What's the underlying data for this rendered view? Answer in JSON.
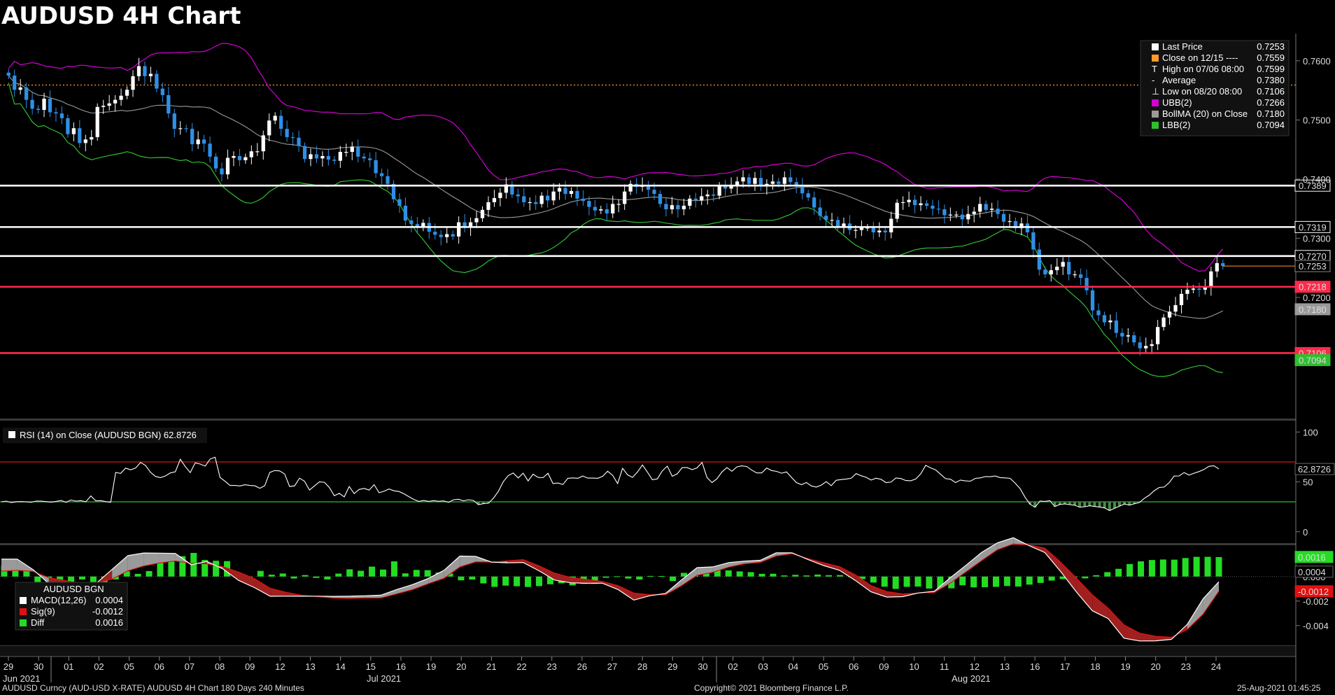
{
  "title": "AUDUSD 4H Chart",
  "footer": {
    "left": "AUDUSD Curncy (AUD-USD X-RATE) AUDUSD 4H Chart 180 Days 240 Minutes",
    "center": "Copyright© 2021 Bloomberg Finance L.P.",
    "right": "25-Aug-2021 01:45:25"
  },
  "colors": {
    "up": "#ffffff",
    "down": "#2f8fe6",
    "ubb": "#d400d4",
    "bollma": "#9a9a9a",
    "lbb": "#2fbf2f",
    "hline_white": "#ffffff",
    "hline_red": "#ff2a4a",
    "close_level": "#ff9a2a",
    "macd": "#ffffff",
    "sig": "#e01010",
    "diff": "#22dd22"
  },
  "chart_data": [
    {
      "type": "candlestick",
      "name": "price",
      "ylim": [
        0.7,
        0.7646
      ],
      "y_ticks": [
        "0.7600",
        "0.7500",
        "0.7400",
        "0.7300",
        "0.7200"
      ],
      "x_tick_labels": [
        "29",
        "30",
        "01",
        "02",
        "05",
        "06",
        "07",
        "08",
        "09",
        "12",
        "13",
        "14",
        "15",
        "16",
        "19",
        "20",
        "21",
        "22",
        "23",
        "26",
        "27",
        "28",
        "29",
        "30",
        "02",
        "03",
        "04",
        "05",
        "06",
        "09",
        "10",
        "11",
        "12",
        "13",
        "16",
        "17",
        "18",
        "19",
        "20",
        "23",
        "24"
      ],
      "month_labels": [
        "Jun 2021",
        "Jul 2021",
        "Aug 2021"
      ],
      "legend": [
        {
          "label": "Last Price",
          "value": "0.7253",
          "color": "#ffffff"
        },
        {
          "label": "Close on 12/15 ----",
          "value": "0.7559",
          "color": "#ff9a2a"
        },
        {
          "label": "High on 07/06 08:00",
          "value": "0.7599",
          "color": "none",
          "mark": "T"
        },
        {
          "label": "Average",
          "value": "0.7380",
          "color": "none",
          "mark": "-"
        },
        {
          "label": "Low on 08/20 08:00",
          "value": "0.7106",
          "color": "none",
          "mark": "⊥"
        },
        {
          "label": "UBB(2)",
          "value": "0.7266",
          "color": "#d400d4"
        },
        {
          "label": "BollMA (20)  on Close",
          "value": "0.7180",
          "color": "#9a9a9a"
        },
        {
          "label": "LBB(2)",
          "value": "0.7094",
          "color": "#2fbf2f"
        }
      ],
      "close_level": 0.7559,
      "horizontal_lines": [
        {
          "value": 0.7389,
          "label": "0.7389",
          "color": "#ffffff"
        },
        {
          "value": 0.7319,
          "label": "0.7319",
          "color": "#ffffff"
        },
        {
          "value": 0.727,
          "label": "0.7270",
          "color": "#ffffff"
        },
        {
          "value": 0.7218,
          "label": "0.7218",
          "color": "#ff2a4a"
        },
        {
          "value": 0.7106,
          "label": "0.7106",
          "color": "#ff2a4a"
        }
      ],
      "value_tags": [
        {
          "value": 0.7253,
          "label": "0.7253",
          "bg": "#000000",
          "fg": "#ffffff",
          "border": "#888888"
        },
        {
          "value": 0.718,
          "label": "0.7180",
          "bg": "#9a9a9a",
          "fg": "#000000",
          "border": "#9a9a9a"
        },
        {
          "value": 0.7094,
          "label": "0.7094",
          "bg": "#2fbf2f",
          "fg": "#000000",
          "border": "#2fbf2f"
        }
      ],
      "series": [
        {
          "name": "Close",
          "values": [
            0.7575,
            0.7551,
            0.7555,
            0.7534,
            0.7519,
            0.7517,
            0.7536,
            0.7513,
            0.7511,
            0.7503,
            0.7476,
            0.7486,
            0.7461,
            0.7467,
            0.7471,
            0.7522,
            0.7524,
            0.7528,
            0.7534,
            0.7541,
            0.7551,
            0.7574,
            0.7591,
            0.7574,
            0.7578,
            0.7553,
            0.7542,
            0.7511,
            0.7485,
            0.7486,
            0.7485,
            0.7459,
            0.7467,
            0.746,
            0.7438,
            0.7418,
            0.7408,
            0.7436,
            0.7439,
            0.7432,
            0.7437,
            0.7447,
            0.7447,
            0.7474,
            0.7499,
            0.7507,
            0.7485,
            0.7471,
            0.747,
            0.7456,
            0.7434,
            0.7442,
            0.7435,
            0.7439,
            0.7433,
            0.7431,
            0.7446,
            0.7446,
            0.7455,
            0.7438,
            0.7435,
            0.7432,
            0.741,
            0.7405,
            0.7392,
            0.7366,
            0.7355,
            0.733,
            0.7324,
            0.7318,
            0.7326,
            0.7311,
            0.7306,
            0.7302,
            0.7307,
            0.7303,
            0.7327,
            0.7318,
            0.7327,
            0.7334,
            0.7348,
            0.7361,
            0.7368,
            0.7377,
            0.7391,
            0.7374,
            0.7371,
            0.7361,
            0.7361,
            0.7358,
            0.7372,
            0.7364,
            0.7379,
            0.7385,
            0.7375,
            0.738,
            0.7367,
            0.7363,
            0.7353,
            0.7347,
            0.7349,
            0.7342,
            0.7358,
            0.7358,
            0.7379,
            0.7392,
            0.7387,
            0.7389,
            0.7382,
            0.7375,
            0.7358,
            0.7349,
            0.7356,
            0.7349,
            0.7355,
            0.7367,
            0.7364,
            0.7371,
            0.7374,
            0.7372,
            0.7389,
            0.7384,
            0.7389,
            0.7396,
            0.7403,
            0.7392,
            0.7402,
            0.7388,
            0.7392,
            0.7396,
            0.7392,
            0.7403,
            0.7395,
            0.739,
            0.7376,
            0.7369,
            0.7352,
            0.7338,
            0.7331,
            0.7331,
            0.732,
            0.7325,
            0.7314,
            0.7314,
            0.7318,
            0.7318,
            0.731,
            0.7313,
            0.731,
            0.7333,
            0.736,
            0.7361,
            0.7365,
            0.7356,
            0.7359,
            0.7355,
            0.735,
            0.7349,
            0.7339,
            0.734,
            0.734,
            0.7332,
            0.7341,
            0.7345,
            0.7358,
            0.7348,
            0.735,
            0.7341,
            0.7328,
            0.7329,
            0.7317,
            0.7325,
            0.731,
            0.7281,
            0.7247,
            0.7239,
            0.7246,
            0.7252,
            0.726,
            0.7239,
            0.7239,
            0.7233,
            0.7212,
            0.7178,
            0.717,
            0.7158,
            0.7161,
            0.714,
            0.7134,
            0.7136,
            0.7124,
            0.7114,
            0.7118,
            0.7121,
            0.715,
            0.7166,
            0.7176,
            0.7187,
            0.7206,
            0.7213,
            0.7215,
            0.7213,
            0.7217,
            0.7244,
            0.7258,
            0.7253
          ]
        }
      ]
    },
    {
      "type": "line",
      "name": "rsi",
      "legend": "RSI (14)  on Close (AUDUSD BGN) 62.8726",
      "ylim": [
        -10,
        110
      ],
      "y_ticks": [
        "100",
        "50",
        "0"
      ],
      "levels": [
        70,
        30
      ],
      "last_value_label": "62.8726",
      "series": [
        {
          "name": "RSI (14)",
          "values": [
            30.0,
            30.7,
            29.2,
            30.1,
            30.2,
            30.0,
            29.6,
            30.8,
            30.6,
            30.2,
            29.7,
            30.4,
            31.3,
            29.6,
            31.8,
            30.7,
            31.2,
            30.1,
            35.9,
            31.0,
            31.2,
            30.2,
            29.6,
            59.5,
            58.5,
            63.8,
            62.1,
            63.9,
            69.5,
            66.5,
            59.6,
            55.5,
            54.3,
            56.0,
            59.0,
            60.2,
            72.7,
            65.4,
            59.3,
            69.1,
            67.9,
            65.8,
            72.9,
            74.8,
            54.4,
            50.6,
            46.4,
            46.4,
            45.9,
            47.1,
            46.4,
            46.1,
            43.6,
            46.2,
            59.4,
            61.4,
            61.0,
            57.9,
            45.4,
            46.0,
            53.7,
            50.7,
            41.8,
            45.9,
            50.1,
            49.6,
            44.4,
            36.1,
            38.5,
            35.0,
            45.4,
            38.3,
            42.4,
            43.5,
            41.8,
            47.2,
            39.1,
            40.6,
            42.9,
            41.0,
            40.4,
            38.1,
            35.2,
            32.4,
            30.4,
            31.3,
            30.4,
            31.2,
            30.5,
            30.9,
            29.5,
            32.1,
            32.6,
            31.0,
            32.1,
            31.3,
            27.2,
            28.2,
            28.6,
            33.5,
            40.4,
            50.2,
            56.3,
            58.9,
            54.0,
            58.7,
            51.0,
            57.7,
            54.5,
            54.2,
            58.6,
            48.3,
            48.9,
            47.3,
            53.6,
            54.0,
            53.6,
            55.9,
            53.8,
            53.8,
            53.6,
            55.6,
            60.7,
            56.6,
            48.3,
            63.6,
            57.1,
            54.5,
            59.9,
            67.0,
            59.8,
            52.1,
            53.0,
            61.1,
            65.8,
            55.6,
            58.1,
            64.4,
            64.3,
            62.3,
            64.1,
            69.5,
            54.3,
            49.3,
            53.1,
            60.0,
            64.3,
            60.7,
            65.0,
            66.1,
            65.4,
            61.8,
            59.0,
            59.0,
            63.9,
            61.4,
            60.5,
            58.7,
            60.0,
            54.5,
            49.3,
            47.2,
            49.4,
            45.9,
            44.8,
            46.8,
            50.2,
            46.2,
            51.6,
            52.3,
            52.9,
            53.6,
            58.3,
            56.2,
            54.6,
            51.8,
            53.7,
            52.6,
            49.3,
            49.7,
            53.9,
            53.4,
            51.3,
            51.1,
            52.9,
            58.1,
            66.6,
            64.0,
            62.0,
            57.6,
            53.2,
            52.7,
            49.3,
            51.8,
            51.0,
            50.7,
            53.5,
            54.0,
            55.3,
            55.2,
            55.9,
            54.3,
            54.0,
            53.5,
            48.8,
            43.3,
            34.6,
            27.7,
            24.6,
            30.7,
            30.4,
            31.2,
            25.3,
            27.4,
            28.0,
            27.2,
            26.6,
            24.7,
            25.1,
            26.1,
            25.4,
            24.8,
            23.9,
            21.2,
            23.6,
            25.7,
            27.8,
            26.7,
            28.1,
            29.3,
            33.6,
            36.7,
            41.2,
            44.4,
            44.8,
            49.2,
            55.8,
            56.0,
            59.3,
            56.8,
            58.7,
            60.3,
            62.4,
            65.6,
            66.2,
            62.9
          ]
        }
      ]
    },
    {
      "type": "bar+line",
      "name": "macd",
      "legend_title": "AUDUSD BGN",
      "legend": [
        {
          "label": "MACD(12,26)",
          "value": "0.0004",
          "color": "#ffffff"
        },
        {
          "label": "Sig(9)",
          "value": "-0.0012",
          "color": "#e01010"
        },
        {
          "label": "Diff",
          "value": "0.0016",
          "color": "#22dd22"
        }
      ],
      "ylim": [
        -0.0055,
        0.0025
      ],
      "y_ticks": [
        "0.000",
        "-0.002",
        "-0.004"
      ],
      "value_tags": [
        {
          "value": 0.0016,
          "label": "0.0016",
          "bg": "#22dd22",
          "fg": "#000000"
        },
        {
          "value": 0.0004,
          "label": "0.0004",
          "bg": "#000000",
          "fg": "#ffffff"
        },
        {
          "value": -0.0012,
          "label": "-0.0012",
          "bg": "#e01010",
          "fg": "#ffffff"
        }
      ],
      "series": [
        {
          "name": "MACD(12,26)",
          "values": [
            0.00142,
            0.00142,
            0.00057,
            -0.00057,
            -0.0007,
            -0.00093,
            -0.00056,
            0.00058,
            0.00171,
            0.00192,
            0.00191,
            0.00189,
            0.00097,
            0.00123,
            0.00063,
            -0.00031,
            -0.0009,
            -0.00161,
            -0.0016,
            -0.00161,
            -0.0016,
            -0.00162,
            -0.0016,
            -0.00157,
            -0.00152,
            -0.00106,
            -0.00066,
            -0.00015,
            0.00051,
            0.00167,
            0.00164,
            0.00118,
            0.00112,
            0.00115,
            0.00047,
            -0.00029,
            -0.00051,
            -0.00055,
            -0.00054,
            -0.00106,
            -0.00192,
            -0.00157,
            -0.00138,
            -0.00029,
            0.00073,
            0.00079,
            0.00114,
            0.00126,
            0.00133,
            0.00194,
            0.00194,
            0.0014,
            0.0009,
            0.00051,
            -0.00031,
            -0.00125,
            -0.00168,
            -0.00164,
            -0.00134,
            -0.00121,
            -0.00011,
            0.00091,
            0.00197,
            0.00276,
            0.00317,
            0.00252,
            0.00196,
            0.0004,
            -0.00127,
            -0.00279,
            -0.00343,
            -0.00503,
            -0.00526,
            -0.00525,
            -0.00513,
            -0.00391,
            -0.00182,
            -0.00042
          ]
        },
        {
          "name": "Sig(9)",
          "values": [
            0.00044,
            0.00051,
            0.00042,
            -9e-05,
            -0.00032,
            -0.00057,
            -0.0005,
            -0.00021,
            0.00047,
            0.00086,
            0.00111,
            0.00127,
            0.00109,
            0.00103,
            0.00081,
            0.00037,
            -0.00017,
            -0.00096,
            -0.00129,
            -0.00153,
            -0.00164,
            -0.00176,
            -0.00178,
            -0.00176,
            -0.00175,
            -0.00142,
            -0.00107,
            -0.00059,
            -0.00014,
            0.00078,
            0.0012,
            0.00118,
            0.00128,
            0.00138,
            0.00088,
            0.00027,
            -8e-05,
            -0.00023,
            -0.0004,
            -0.00074,
            -0.00135,
            -0.00148,
            -0.00149,
            -0.00076,
            0.0001,
            0.00035,
            0.00077,
            0.00104,
            0.00116,
            0.00168,
            0.00186,
            0.00148,
            0.00112,
            0.00081,
            0.00015,
            -0.00074,
            -0.00123,
            -0.00142,
            -0.00134,
            -0.0013,
            -0.00055,
            0.00037,
            0.0013,
            0.00219,
            0.00266,
            0.00258,
            0.00231,
            0.00117,
            -0.00014,
            -0.0015,
            -0.00258,
            -0.00395,
            -0.00462,
            -0.00488,
            -0.00496,
            -0.00433,
            -0.00308,
            -0.0012
          ]
        },
        {
          "name": "Diff",
          "values": [
            0.00091,
            0.00093,
            0.00055,
            -0.00087,
            -0.00043,
            -0.00053,
            -0.00075,
            -0.00024,
            -0.00096,
            -0.00085,
            -0.00024,
            0.00043,
            0.00022,
            0.00045,
            0.0012,
            0.00131,
            0.00166,
            0.00193,
            0.00135,
            0.00129,
            0.00126,
            0.00015,
            -0.0,
            0.00046,
            0.00015,
            0.00025,
            -0.00016,
            0.00012,
            -0.00011,
            -0.00024,
            0.00024,
            0.00059,
            0.00047,
            0.00081,
            0.00057,
            0.00124,
            0.00026,
            0.00054,
            0.00052,
            0.00033,
            0.00024,
            -0.00031,
            -0.00025,
            -0.00056,
            -0.00084,
            -0.00074,
            -0.00079,
            -0.00085,
            -0.00078,
            -0.00063,
            -0.00055,
            -0.00072,
            -0.0006,
            -0.0006,
            -0.0001,
            2e-05,
            -0.00016,
            -0.00025,
            5e-05,
            4e-05,
            -0.00037,
            0.0003,
            0.00044,
            0.00037,
            0.00053,
            0.0005,
            0.00042,
            0.00036,
            0.00022,
            0.00023,
            9e-05,
            0.00014,
            9e-05,
            0.00016,
            0.00011,
            0.00012,
            2e-05,
            -0.00021,
            -0.00049,
            -0.00083,
            -0.00101,
            -0.00084,
            -0.00082,
            -0.00098,
            -0.00093,
            -0.00096,
            -0.00071,
            -0.00088,
            -0.00087,
            -0.00084,
            -0.00077,
            -0.00082,
            -0.00066,
            -0.00052,
            -0.00033,
            -0.00021,
            -8e-05,
            -0.00015,
            0.00011,
            0.00036,
            0.00063,
            0.00102,
            0.00124,
            0.00135,
            0.00139,
            0.00138,
            0.00151,
            0.00161,
            0.00161,
            0.00159
          ]
        }
      ]
    }
  ]
}
